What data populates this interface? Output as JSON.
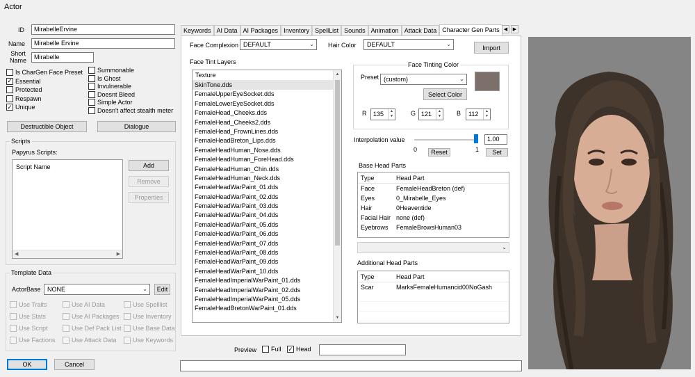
{
  "window": {
    "title": "Actor"
  },
  "form": {
    "id_label": "ID",
    "id_value": "MirabelleErvine",
    "name_label": "Name",
    "name_value": "Mirabelle Ervine",
    "short_name_label": "Short\nName",
    "short_name_value": "Mirabelle"
  },
  "flags_left": [
    {
      "label": "Is CharGen Face Preset",
      "checked": false
    },
    {
      "label": "Essential",
      "checked": true
    },
    {
      "label": "Protected",
      "checked": false
    },
    {
      "label": "Respawn",
      "checked": false
    },
    {
      "label": "Unique",
      "checked": true
    }
  ],
  "flags_right": [
    {
      "label": "Summonable",
      "checked": false
    },
    {
      "label": "Is Ghost",
      "checked": false
    },
    {
      "label": "Invulnerable",
      "checked": false
    },
    {
      "label": "Doesnt Bleed",
      "checked": false
    },
    {
      "label": "Simple Actor",
      "checked": false
    },
    {
      "label": "Doesn't affect stealth meter",
      "checked": false
    }
  ],
  "buttons": {
    "destructible": "Destructible Object",
    "dialogue": "Dialogue",
    "add": "Add",
    "remove": "Remove",
    "properties": "Properties",
    "edit": "Edit",
    "ok": "OK",
    "cancel": "Cancel",
    "import": "Import",
    "select_color": "Select Color",
    "reset": "Reset",
    "set": "Set"
  },
  "scripts": {
    "group_title": "Scripts",
    "papyrus_label": "Papyrus Scripts:",
    "column": "Script Name"
  },
  "template": {
    "group_title": "Template Data",
    "actorbase_label": "ActorBase",
    "actorbase_value": "NONE",
    "options": [
      "Use Traits",
      "Use AI Data",
      "Use Spelllist",
      "Use Stats",
      "Use AI Packages",
      "Use Inventory",
      "Use Script",
      "Use Def Pack List",
      "Use Base Data",
      "Use Factions",
      "Use Attack Data",
      "Use Keywords"
    ]
  },
  "tabs": [
    "Keywords",
    "AI Data",
    "AI Packages",
    "Inventory",
    "SpellList",
    "Sounds",
    "Animation",
    "Attack Data",
    "Character Gen Parts"
  ],
  "active_tab": "Character Gen Parts",
  "chargen": {
    "face_complexion_label": "Face Complexion",
    "face_complexion_value": "DEFAULT",
    "hair_color_label": "Hair Color",
    "hair_color_value": "DEFAULT",
    "face_tint_layers_label": "Face Tint Layers",
    "texture_column": "Texture",
    "textures": [
      "SkinTone.dds",
      "FemaleUpperEyeSocket.dds",
      "FemaleLowerEyeSocket.dds",
      "FemaleHead_Cheeks.dds",
      "FemaleHead_Cheeks2.dds",
      "FemaleHead_FrownLines.dds",
      "FemaleHeadBreton_Lips.dds",
      "FemaleHeadHuman_Nose.dds",
      "FemaleHeadHuman_ForeHead.dds",
      "FemaleHeadHuman_Chin.dds",
      "FemaleHeadHuman_Neck.dds",
      "FemaleHeadWarPaint_01.dds",
      "FemaleHeadWarPaint_02.dds",
      "FemaleHeadWarPaint_03.dds",
      "FemaleHeadWarPaint_04.dds",
      "FemaleHeadWarPaint_05.dds",
      "FemaleHeadWarPaint_06.dds",
      "FemaleHeadWarPaint_07.dds",
      "FemaleHeadWarPaint_08.dds",
      "FemaleHeadWarPaint_09.dds",
      "FemaleHeadWarPaint_10.dds",
      "FemaleHeadImperialWarPaint_01.dds",
      "FemaleHeadImperialWarPaint_02.dds",
      "FemaleHeadImperialWarPaint_05.dds",
      "FemaleHeadBretonWarPaint_01.dds"
    ],
    "face_tinting_color_title": "Face Tinting Color",
    "preset_label": "Preset",
    "preset_value": "(custom)",
    "swatch_color": "#7d6f6a",
    "r_label": "R",
    "r_value": "135",
    "g_label": "G",
    "g_value": "121",
    "b_label": "B",
    "b_value": "112",
    "interpolation_label": "Interpolation value",
    "interpolation_value": "1.00",
    "interpolation_level": 1.0,
    "slider_min": "0",
    "slider_max": "1",
    "base_head_parts_label": "Base Head Parts",
    "col_type": "Type",
    "col_head_part": "Head Part",
    "base_head_parts": [
      {
        "type": "Face",
        "part": "FemaleHeadBreton (def)"
      },
      {
        "type": "Eyes",
        "part": "0_Mirabelle_Eyes"
      },
      {
        "type": "Hair",
        "part": "0Heaventide"
      },
      {
        "type": "Facial Hair",
        "part": "none (def)"
      },
      {
        "type": "Eyebrows",
        "part": "FemaleBrowsHuman03"
      }
    ],
    "additional_head_parts_label": "Additional Head Parts",
    "additional_head_parts": [
      {
        "type": "Scar",
        "part": "MarksFemaleHumancid00NoGash"
      }
    ]
  },
  "preview": {
    "label": "Preview",
    "full_label": "Full",
    "full_checked": false,
    "head_label": "Head",
    "head_checked": true
  },
  "colors": {
    "accent": "#0078d7",
    "preview_bg": "#858585"
  }
}
